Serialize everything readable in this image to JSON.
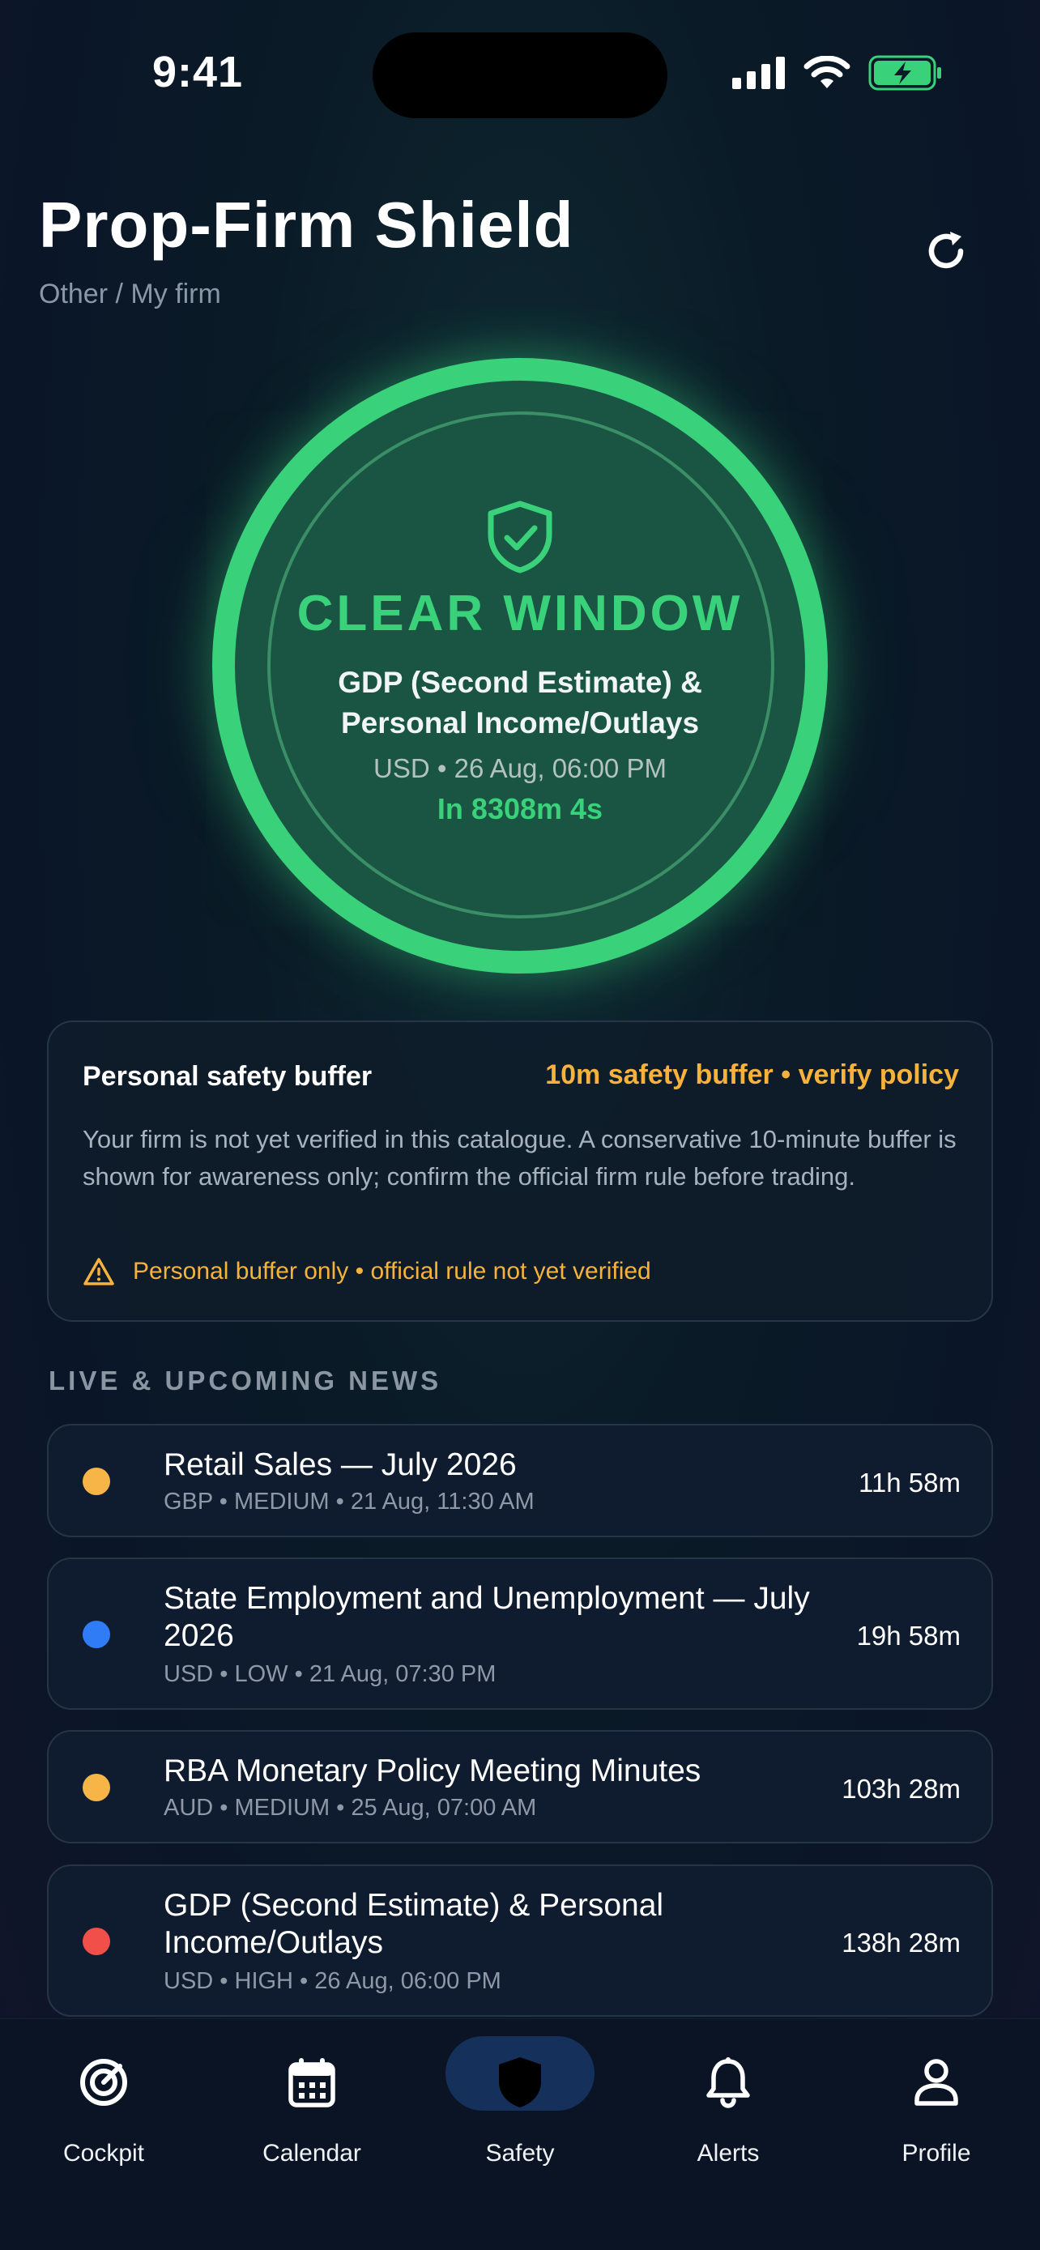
{
  "status_bar": {
    "time": "9:41"
  },
  "header": {
    "title": "Prop-Firm Shield",
    "subtitle": "Other / My firm",
    "refresh_icon": "refresh-icon"
  },
  "hero": {
    "status": "CLEAR WINDOW",
    "event_name": "GDP (Second Estimate) & Personal Income/Outlays",
    "event_meta": "USD • 26 Aug, 06:00 PM",
    "countdown": "In 8308m 4s",
    "accent_color": "#39d17a",
    "icon": "shield-check-icon"
  },
  "buffer": {
    "title": "Personal safety buffer",
    "tag": "10m safety buffer • verify policy",
    "description": "Your firm is not yet verified in this catalogue. A conservative 10-minute buffer is shown for awareness only; confirm the official firm rule before trading.",
    "warning": "Personal buffer only • official rule not yet verified",
    "warning_color": "#f7b23c"
  },
  "news": {
    "section_label": "LIVE & UPCOMING NEWS",
    "items": [
      {
        "title": "Retail Sales — July 2026",
        "meta": "GBP • MEDIUM • 21 Aug, 11:30 AM",
        "time": "11h 58m",
        "dot_color": "#f8b547"
      },
      {
        "title": "State Employment and Unemployment — July 2026",
        "meta": "USD • LOW • 21 Aug, 07:30 PM",
        "time": "19h 58m",
        "dot_color": "#2f7cf6"
      },
      {
        "title": "RBA Monetary Policy Meeting Minutes",
        "meta": "AUD • MEDIUM • 25 Aug, 07:00 AM",
        "time": "103h 28m",
        "dot_color": "#f8b547"
      },
      {
        "title": "GDP (Second Estimate) & Personal Income/Outlays",
        "meta": "USD • HIGH • 26 Aug, 06:00 PM",
        "time": "138h 28m",
        "dot_color": "#f1504a"
      }
    ]
  },
  "nav": {
    "items": [
      {
        "label": "Cockpit",
        "icon": "target-icon"
      },
      {
        "label": "Calendar",
        "icon": "calendar-icon"
      },
      {
        "label": "Safety",
        "icon": "shield-icon",
        "active": true
      },
      {
        "label": "Alerts",
        "icon": "bell-icon"
      },
      {
        "label": "Profile",
        "icon": "person-icon"
      }
    ]
  }
}
